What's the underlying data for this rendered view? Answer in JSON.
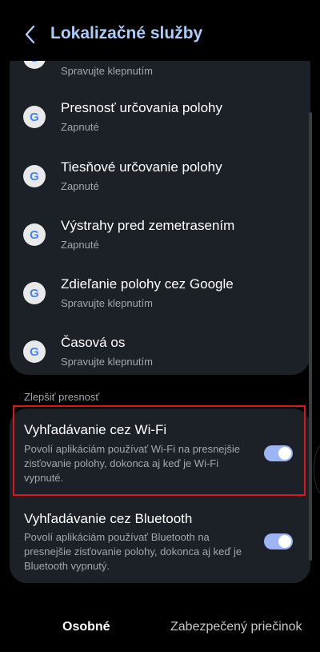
{
  "header": {
    "title": "Lokalizačné služby"
  },
  "list": {
    "partial_subtitle": "Spravujte klepnutím",
    "items": [
      {
        "title": "Presnosť určovania polohy",
        "subtitle": "Zapnuté"
      },
      {
        "title": "Tiesňové určovanie polohy",
        "subtitle": "Zapnuté"
      },
      {
        "title": "Výstrahy pred zemetrasením",
        "subtitle": "Zapnuté"
      },
      {
        "title": "Zdieľanie polohy cez Google",
        "subtitle": "Spravujte klepnutím"
      },
      {
        "title": "Časová os",
        "subtitle": "Spravujte klepnutím"
      }
    ],
    "icon_letter": "G"
  },
  "improve": {
    "section_title": "Zlepšiť presnosť",
    "wifi": {
      "title": "Vyhľadávanie cez Wi-Fi",
      "description": "Povolí aplikáciám používať Wi-Fi na presnejšie zisťovanie polohy, dokonca aj keď je Wi-Fi vypnuté.",
      "enabled": true
    },
    "bluetooth": {
      "title": "Vyhľadávanie cez Bluetooth",
      "description": "Povolí aplikáciám používať Bluetooth na presnejšie zisťovanie polohy, dokonca aj keď je Bluetooth vypnutý.",
      "enabled": true
    }
  },
  "bottom_tabs": {
    "personal": "Osobné",
    "secure": "Zabezpečený priečinok"
  },
  "colors": {
    "accent": "#aecbfa",
    "toggle_on": "#9db4f5",
    "highlight": "#e0141e"
  }
}
